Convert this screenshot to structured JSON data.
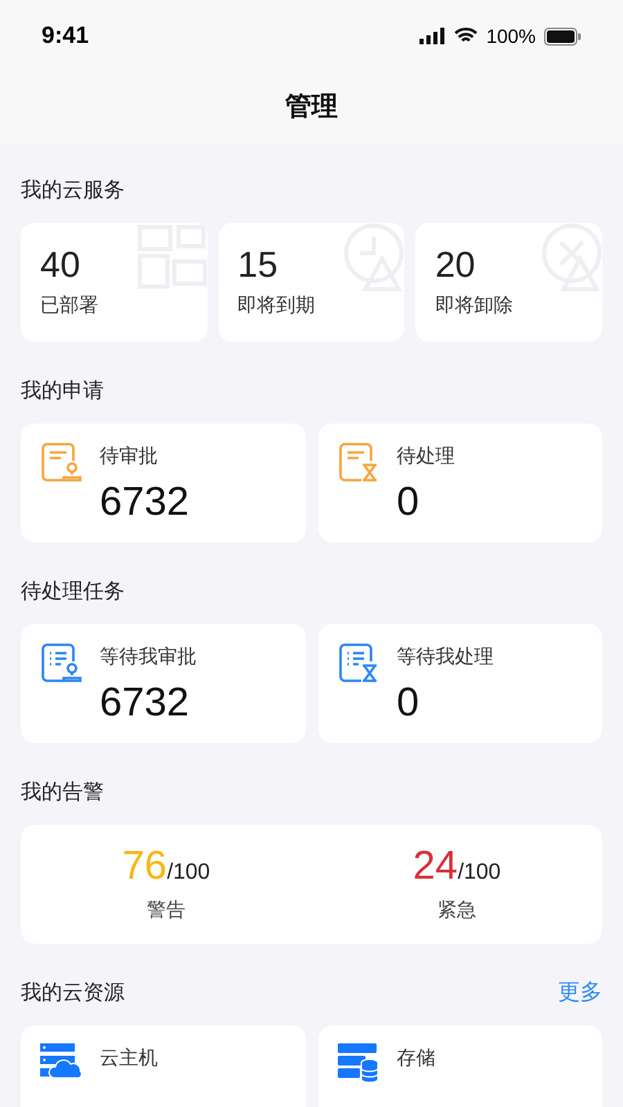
{
  "status_bar": {
    "time": "9:41",
    "battery": "100%"
  },
  "header": {
    "title": "管理"
  },
  "cloud_services": {
    "title": "我的云服务",
    "items": [
      {
        "value": "40",
        "label": "已部署"
      },
      {
        "value": "15",
        "label": "即将到期"
      },
      {
        "value": "20",
        "label": "即将卸除"
      }
    ]
  },
  "my_requests": {
    "title": "我的申请",
    "items": [
      {
        "label": "待审批",
        "value": "6732"
      },
      {
        "label": "待处理",
        "value": "0"
      }
    ]
  },
  "pending_tasks": {
    "title": "待处理任务",
    "items": [
      {
        "label": "等待我审批",
        "value": "6732"
      },
      {
        "label": "等待我处理",
        "value": "0"
      }
    ]
  },
  "alerts": {
    "title": "我的告警",
    "items": [
      {
        "value": "76",
        "total": "/100",
        "label": "警告",
        "color": "#f8b714"
      },
      {
        "value": "24",
        "total": "/100",
        "label": "紧急",
        "color": "#d8303a"
      }
    ]
  },
  "cloud_resources": {
    "title": "我的云资源",
    "more": "更多",
    "items": [
      {
        "label": "云主机"
      },
      {
        "label": "存储"
      }
    ]
  }
}
